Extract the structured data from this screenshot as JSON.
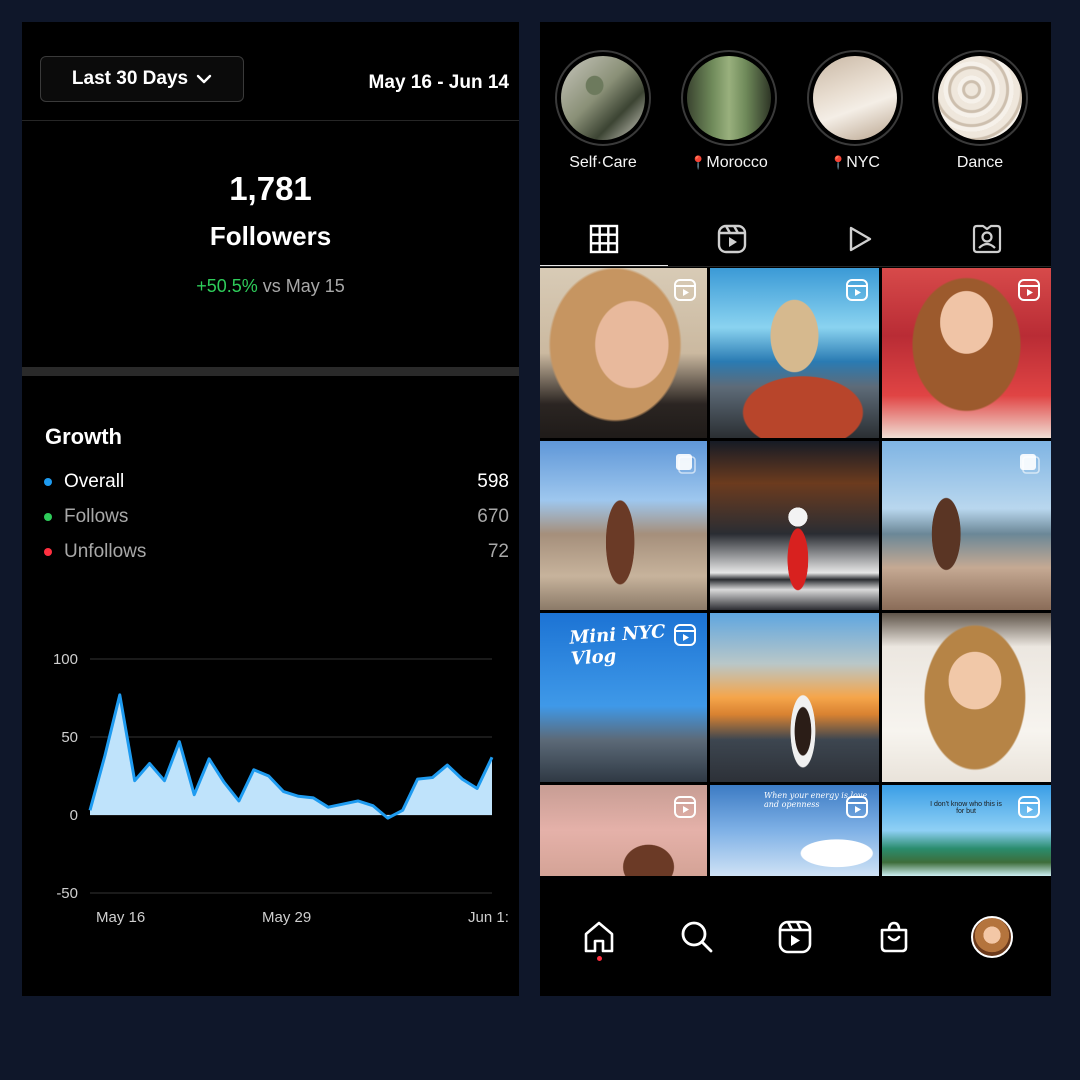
{
  "insights": {
    "range_label": "Last 30 Days",
    "date_range": "May 16 - Jun 14",
    "followers_count": "1,781",
    "followers_label": "Followers",
    "change_pct": "+50.5%",
    "change_ref": "vs May 15",
    "growth_title": "Growth",
    "legend": [
      {
        "label": "Overall",
        "value": "598",
        "color": "#1e9bf0"
      },
      {
        "label": "Follows",
        "value": "670",
        "color": "#2ecc5a"
      },
      {
        "label": "Unfollows",
        "value": "72",
        "color": "#ff3040"
      }
    ]
  },
  "chart_data": {
    "type": "area",
    "x_ticks": [
      "May 16",
      "May 29",
      "Jun 1:"
    ],
    "y_ticks": [
      "100",
      "50",
      "0",
      "-50"
    ],
    "ylim": [
      -50,
      100
    ],
    "grid": true,
    "series": [
      {
        "values": [
          3,
          38,
          77,
          22,
          33,
          22,
          47,
          13,
          36,
          21,
          9,
          29,
          25,
          15,
          12,
          11,
          5,
          7,
          9,
          6,
          -2,
          3,
          23,
          24,
          32,
          23,
          17,
          37
        ]
      }
    ],
    "colors": {
      "line": "#1e9bf0",
      "fill": "#bfe3fb",
      "grid": "#333333",
      "tick": "#cfcfcf"
    }
  },
  "profile": {
    "highlights": [
      {
        "label": "Self·Care",
        "pin": false
      },
      {
        "label": "Morocco",
        "pin": true
      },
      {
        "label": "NYC",
        "pin": true
      },
      {
        "label": "Dance",
        "pin": false
      }
    ],
    "tabs": [
      {
        "icon": "grid-icon",
        "active": true
      },
      {
        "icon": "reels-icon",
        "active": false
      },
      {
        "icon": "video-play-icon",
        "active": false
      },
      {
        "icon": "tagged-icon",
        "active": false
      }
    ],
    "grid_captions": {
      "mini_nyc": "Mini NYC Vlog",
      "energy": "When your energy is love and openness",
      "dont_know": "I don't know who this is for but"
    },
    "bottom_nav": [
      "home-icon",
      "search-icon",
      "reels-icon",
      "shop-icon",
      "profile-avatar"
    ]
  }
}
